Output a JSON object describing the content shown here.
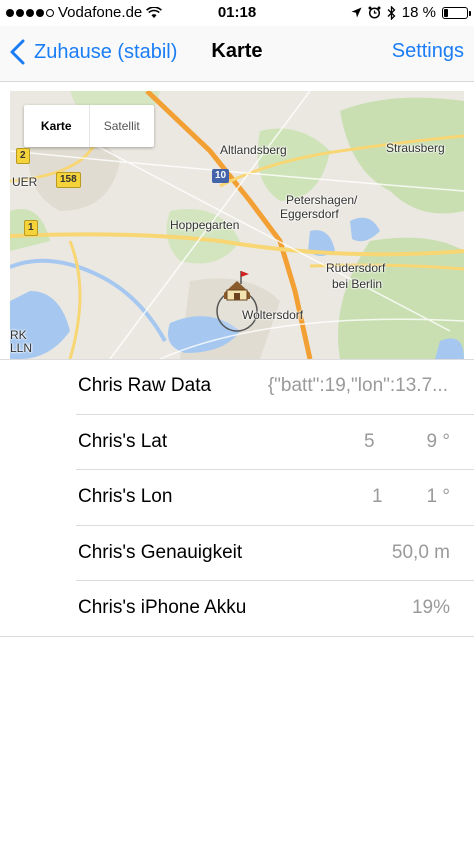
{
  "status_bar": {
    "carrier": "Vodafone.de",
    "time": "01:18",
    "battery_percent": "18 %",
    "battery_level": 0.18
  },
  "nav": {
    "back_label": "Zuhause (stabil)",
    "title": "Karte",
    "settings_label": "Settings"
  },
  "map": {
    "toggle": {
      "karte": "Karte",
      "satellit": "Satellit"
    },
    "places": {
      "altlandsberg": "Altlandsberg",
      "strausberg": "Strausberg",
      "petershagen": "Petershagen/",
      "eggersdorf": "Eggersdorf",
      "hoppegarten": "Hoppegarten",
      "ruedersdorf": "Rüdersdorf",
      "bei_berlin": "bei Berlin",
      "woltersdorf": "Woltersdorf",
      "uer": "UER",
      "rk": "RK",
      "lln": "LLN"
    },
    "road_badges": {
      "b2": "2",
      "b158": "158",
      "b1": "1",
      "a10": "10"
    },
    "colors": {
      "water": "#a6c8f0",
      "forest": "#c9dfb2",
      "highway": "#f2a033",
      "road": "#f7d673"
    }
  },
  "list": {
    "rows": [
      {
        "label": "Chris Raw Data",
        "value": "{\"batt\":19,\"lon\":13.7..."
      },
      {
        "label": "Chris's Lat",
        "value_a": "5",
        "value_b": "9 °"
      },
      {
        "label": "Chris's Lon",
        "value_a": "1",
        "value_b": "1 °"
      },
      {
        "label": "Chris's Genauigkeit",
        "value": "50,0 m"
      },
      {
        "label": "Chris's iPhone Akku",
        "value": "19%"
      }
    ]
  }
}
